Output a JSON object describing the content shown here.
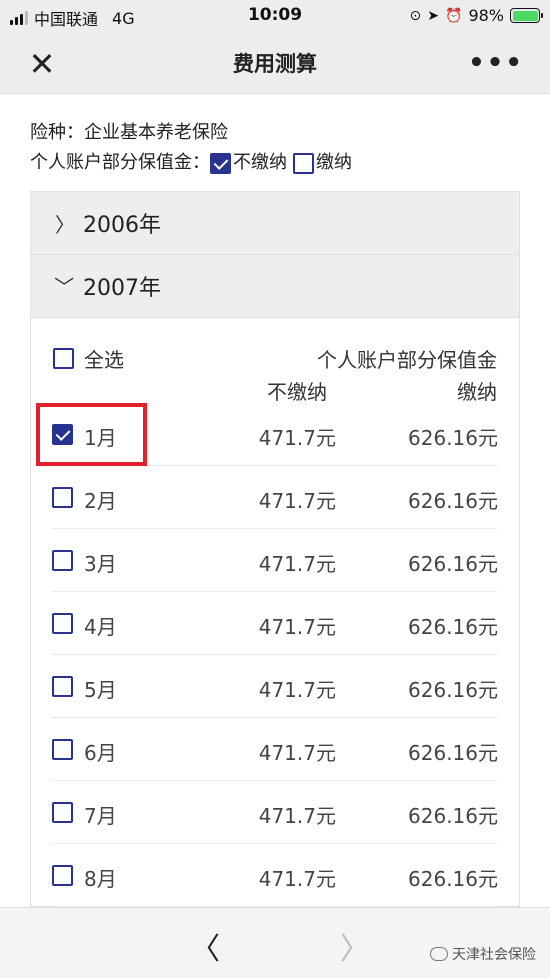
{
  "status_bar": {
    "carrier": "中国联通",
    "network": "4G",
    "time": "10:09",
    "battery": "98%"
  },
  "nav": {
    "title": "费用测算",
    "close_icon": "close-icon",
    "more_icon": "more-icon"
  },
  "info": {
    "insurance_label": "险种：",
    "insurance_value": "企业基本养老保险",
    "account_label": "个人账户部分保值金：",
    "option_no_pay": "不缴纳",
    "option_no_pay_checked": true,
    "option_pay": "缴纳",
    "option_pay_checked": false
  },
  "accordion": {
    "collapsed_year": "2006年",
    "expanded_year": "2007年"
  },
  "table": {
    "select_all": "全选",
    "header_group": "个人账户部分保值金",
    "col_no_pay": "不缴纳",
    "col_pay": "缴纳",
    "rows": [
      {
        "month": "1月",
        "no_pay": "471.7元",
        "pay": "626.16元",
        "checked": true
      },
      {
        "month": "2月",
        "no_pay": "471.7元",
        "pay": "626.16元",
        "checked": false
      },
      {
        "month": "3月",
        "no_pay": "471.7元",
        "pay": "626.16元",
        "checked": false
      },
      {
        "month": "4月",
        "no_pay": "471.7元",
        "pay": "626.16元",
        "checked": false
      },
      {
        "month": "5月",
        "no_pay": "471.7元",
        "pay": "626.16元",
        "checked": false
      },
      {
        "month": "6月",
        "no_pay": "471.7元",
        "pay": "626.16元",
        "checked": false
      },
      {
        "month": "7月",
        "no_pay": "471.7元",
        "pay": "626.16元",
        "checked": false
      },
      {
        "month": "8月",
        "no_pay": "471.7元",
        "pay": "626.16元",
        "checked": false
      }
    ]
  },
  "bottom": {
    "watermark": "天津社会保险"
  },
  "colors": {
    "accent": "#27338f",
    "highlight": "#e0202a"
  }
}
